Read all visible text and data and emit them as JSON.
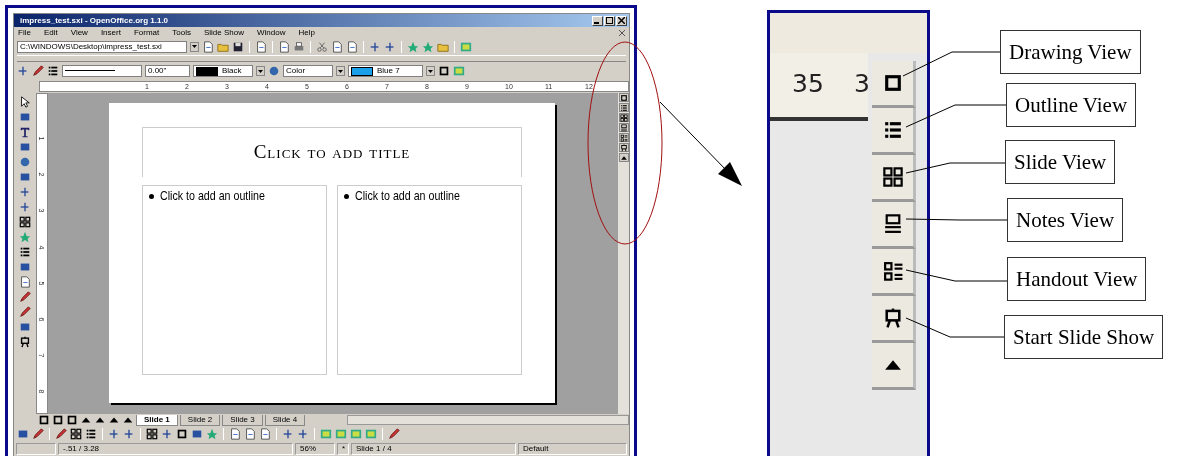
{
  "window": {
    "title": "impress_test.sxi - OpenOffice.org 1.1.0"
  },
  "menu": [
    "File",
    "Edit",
    "View",
    "Insert",
    "Format",
    "Tools",
    "Slide Show",
    "Window",
    "Help"
  ],
  "location": {
    "value": "C:\\WINDOWS\\Desktop\\impress_test.sxi"
  },
  "line_toolbar": {
    "line_width": "0.00\"",
    "line_color": "Black",
    "area_style": "Color",
    "area_color": "Blue 7"
  },
  "ruler": {
    "horizontal": [
      "1",
      "2",
      "3",
      "4",
      "5",
      "6",
      "7",
      "8",
      "9",
      "10",
      "11",
      "12"
    ],
    "vertical": [
      "1",
      "2",
      "3",
      "4",
      "5",
      "6",
      "7",
      "8"
    ]
  },
  "slide": {
    "title": "Click to add title",
    "outlines": [
      "Click to add an outline",
      "Click to add an outline"
    ]
  },
  "slide_tabs": [
    {
      "label": "Slide 1",
      "selected": true
    },
    {
      "label": "Slide 2",
      "selected": false
    },
    {
      "label": "Slide 3",
      "selected": false
    },
    {
      "label": "Slide 4",
      "selected": false
    }
  ],
  "status_bar": {
    "position": "-.51 / 3.28",
    "zoom": "56%",
    "modified": "*",
    "page": "Slide 1 / 4",
    "layout": "Default"
  },
  "detail": {
    "ruler": [
      "35",
      "3"
    ],
    "callouts": [
      "Drawing View",
      "Outline View",
      "Slide View",
      "Notes View",
      "Handout View",
      "Start Slide Show"
    ]
  }
}
